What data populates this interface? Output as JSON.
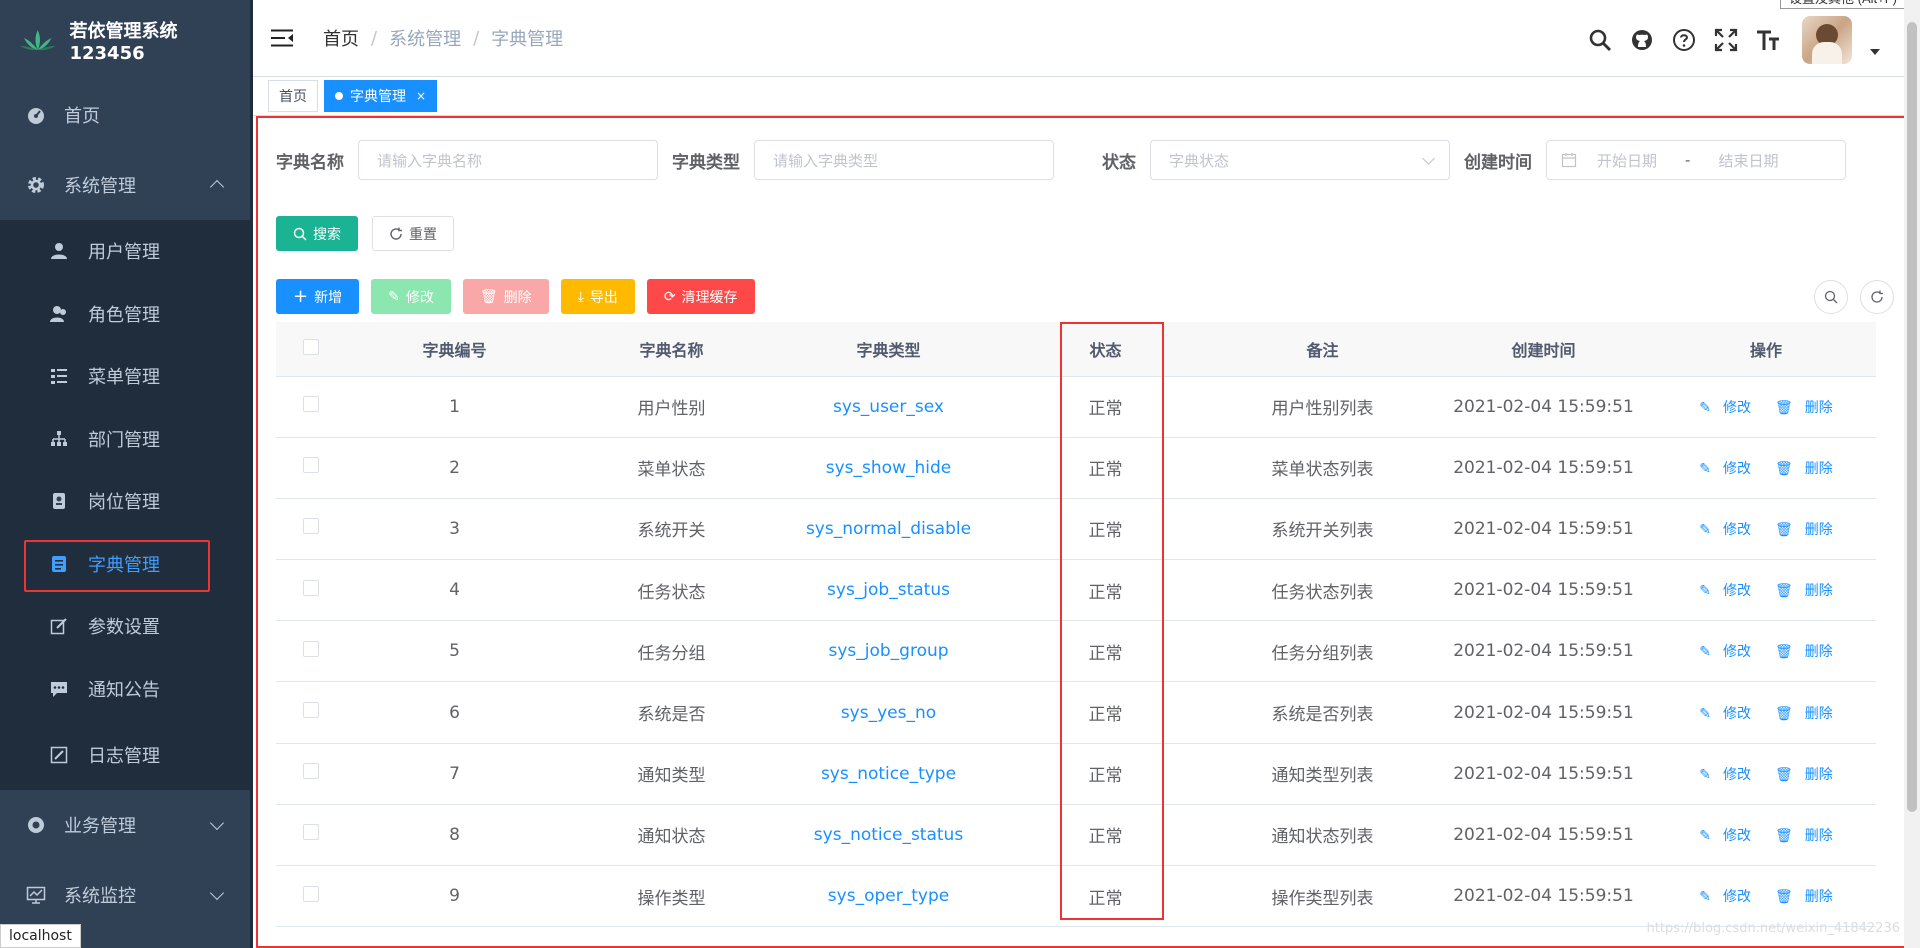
{
  "app": {
    "title": "若依管理系统123456"
  },
  "sidebar": {
    "items": [
      {
        "label": "首页",
        "icon": "dashboard-icon"
      },
      {
        "label": "系统管理",
        "icon": "gear-icon"
      },
      {
        "label": "业务管理",
        "icon": "business-icon"
      },
      {
        "label": "系统监控",
        "icon": "monitor-icon"
      }
    ],
    "sub": [
      {
        "label": "用户管理",
        "icon": "user-icon"
      },
      {
        "label": "角色管理",
        "icon": "peoples-icon"
      },
      {
        "label": "菜单管理",
        "icon": "tree-table-icon"
      },
      {
        "label": "部门管理",
        "icon": "tree-icon"
      },
      {
        "label": "岗位管理",
        "icon": "post-icon"
      },
      {
        "label": "字典管理",
        "icon": "dict-icon"
      },
      {
        "label": "参数设置",
        "icon": "edit-icon"
      },
      {
        "label": "通知公告",
        "icon": "message-icon"
      },
      {
        "label": "日志管理",
        "icon": "log-icon"
      }
    ]
  },
  "breadcrumb": [
    "首页",
    "系统管理",
    "字典管理"
  ],
  "tooltip": "设置及其他 (Alt+F)",
  "tags": {
    "home": "首页",
    "active": "字典管理"
  },
  "search": {
    "name_label": "字典名称",
    "name_placeholder": "请输入字典名称",
    "type_label": "字典类型",
    "type_placeholder": "请输入字典类型",
    "status_label": "状态",
    "status_placeholder": "字典状态",
    "time_label": "创建时间",
    "start_placeholder": "开始日期",
    "range_sep": "-",
    "end_placeholder": "结束日期",
    "search_btn": "搜索",
    "reset_btn": "重置"
  },
  "toolbar": {
    "add": "新增",
    "edit": "修改",
    "delete": "删除",
    "export": "导出",
    "clear": "清理缓存"
  },
  "table": {
    "headers": [
      "字典编号",
      "字典名称",
      "字典类型",
      "状态",
      "备注",
      "创建时间",
      "操作"
    ],
    "op_edit": "修改",
    "op_delete": "删除",
    "rows": [
      {
        "id": "1",
        "name": "用户性别",
        "type": "sys_user_sex",
        "status": "正常",
        "remark": "用户性别列表",
        "time": "2021-02-04 15:59:51"
      },
      {
        "id": "2",
        "name": "菜单状态",
        "type": "sys_show_hide",
        "status": "正常",
        "remark": "菜单状态列表",
        "time": "2021-02-04 15:59:51"
      },
      {
        "id": "3",
        "name": "系统开关",
        "type": "sys_normal_disable",
        "status": "正常",
        "remark": "系统开关列表",
        "time": "2021-02-04 15:59:51"
      },
      {
        "id": "4",
        "name": "任务状态",
        "type": "sys_job_status",
        "status": "正常",
        "remark": "任务状态列表",
        "time": "2021-02-04 15:59:51"
      },
      {
        "id": "5",
        "name": "任务分组",
        "type": "sys_job_group",
        "status": "正常",
        "remark": "任务分组列表",
        "time": "2021-02-04 15:59:51"
      },
      {
        "id": "6",
        "name": "系统是否",
        "type": "sys_yes_no",
        "status": "正常",
        "remark": "系统是否列表",
        "time": "2021-02-04 15:59:51"
      },
      {
        "id": "7",
        "name": "通知类型",
        "type": "sys_notice_type",
        "status": "正常",
        "remark": "通知类型列表",
        "time": "2021-02-04 15:59:51"
      },
      {
        "id": "8",
        "name": "通知状态",
        "type": "sys_notice_status",
        "status": "正常",
        "remark": "通知状态列表",
        "time": "2021-02-04 15:59:51"
      },
      {
        "id": "9",
        "name": "操作类型",
        "type": "sys_oper_type",
        "status": "正常",
        "remark": "操作类型列表",
        "time": "2021-02-04 15:59:51"
      }
    ]
  },
  "statusbar": "localhost",
  "watermark": "https://blog.csdn.net/weixin_41842236"
}
